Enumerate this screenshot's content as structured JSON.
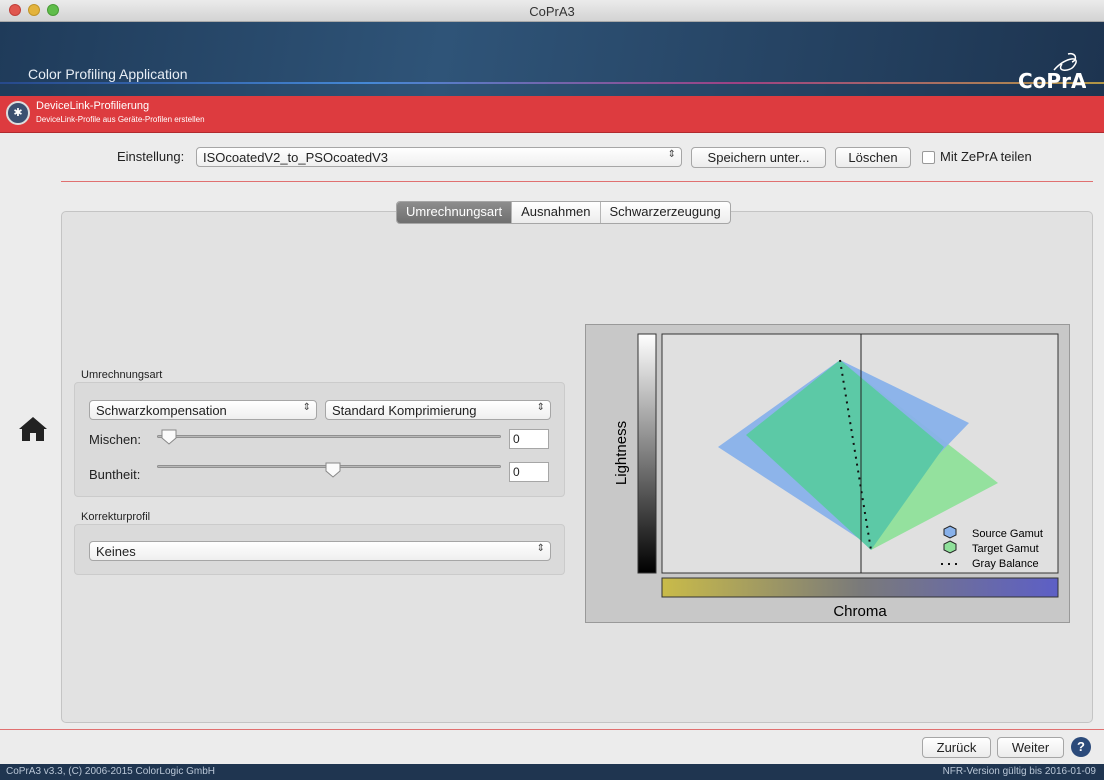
{
  "window": {
    "title": "CoPrA3"
  },
  "banner": {
    "app_name": "Color Profiling Application",
    "logo_text": "CoPrA"
  },
  "subheader": {
    "title": "DeviceLink-Profilierung",
    "subtitle": "DeviceLink-Profile aus Geräte-Profilen erstellen"
  },
  "setting": {
    "label": "Einstellung:",
    "selected": "ISOcoatedV2_to_PSOcoatedV3",
    "save_as": "Speichern unter...",
    "delete": "Löschen",
    "share_label": "Mit ZePrA teilen",
    "share_checked": false
  },
  "tabs": [
    {
      "label": "Umrechnungsart",
      "active": true
    },
    {
      "label": "Ausnahmen",
      "active": false
    },
    {
      "label": "Schwarzerzeugung",
      "active": false
    }
  ],
  "conversion": {
    "title": "Umrechnungsart",
    "method": "Schwarzkompensation",
    "compression": "Standard Komprimierung",
    "mix_label": "Mischen:",
    "mix_value": "0",
    "mix_fraction": 0.0,
    "chroma_label": "Buntheit:",
    "chroma_value": "0",
    "chroma_fraction": 0.5
  },
  "correction": {
    "title": "Korrekturprofil",
    "selected": "Keines"
  },
  "chart_data": {
    "type": "gamut-diagram",
    "xlabel": "Chroma",
    "ylabel": "Lightness",
    "legend": [
      {
        "name": "Source Gamut",
        "color": "#7fa8e6"
      },
      {
        "name": "Target Gamut",
        "color": "#7fd98c"
      },
      {
        "name": "Gray Balance",
        "color": "#111111"
      }
    ],
    "legend_position": "bottom-right",
    "colors": {
      "overlap": "#5cc9a6",
      "chroma_left": "#c9bb49",
      "chroma_right": "#5d5fc6"
    }
  },
  "footer": {
    "back": "Zurück",
    "next": "Weiter",
    "help": "?",
    "copyright": "CoPrA3 v3.3, (C) 2006-2015 ColorLogic GmbH",
    "license": "NFR-Version gültig bis 2016-01-09"
  }
}
